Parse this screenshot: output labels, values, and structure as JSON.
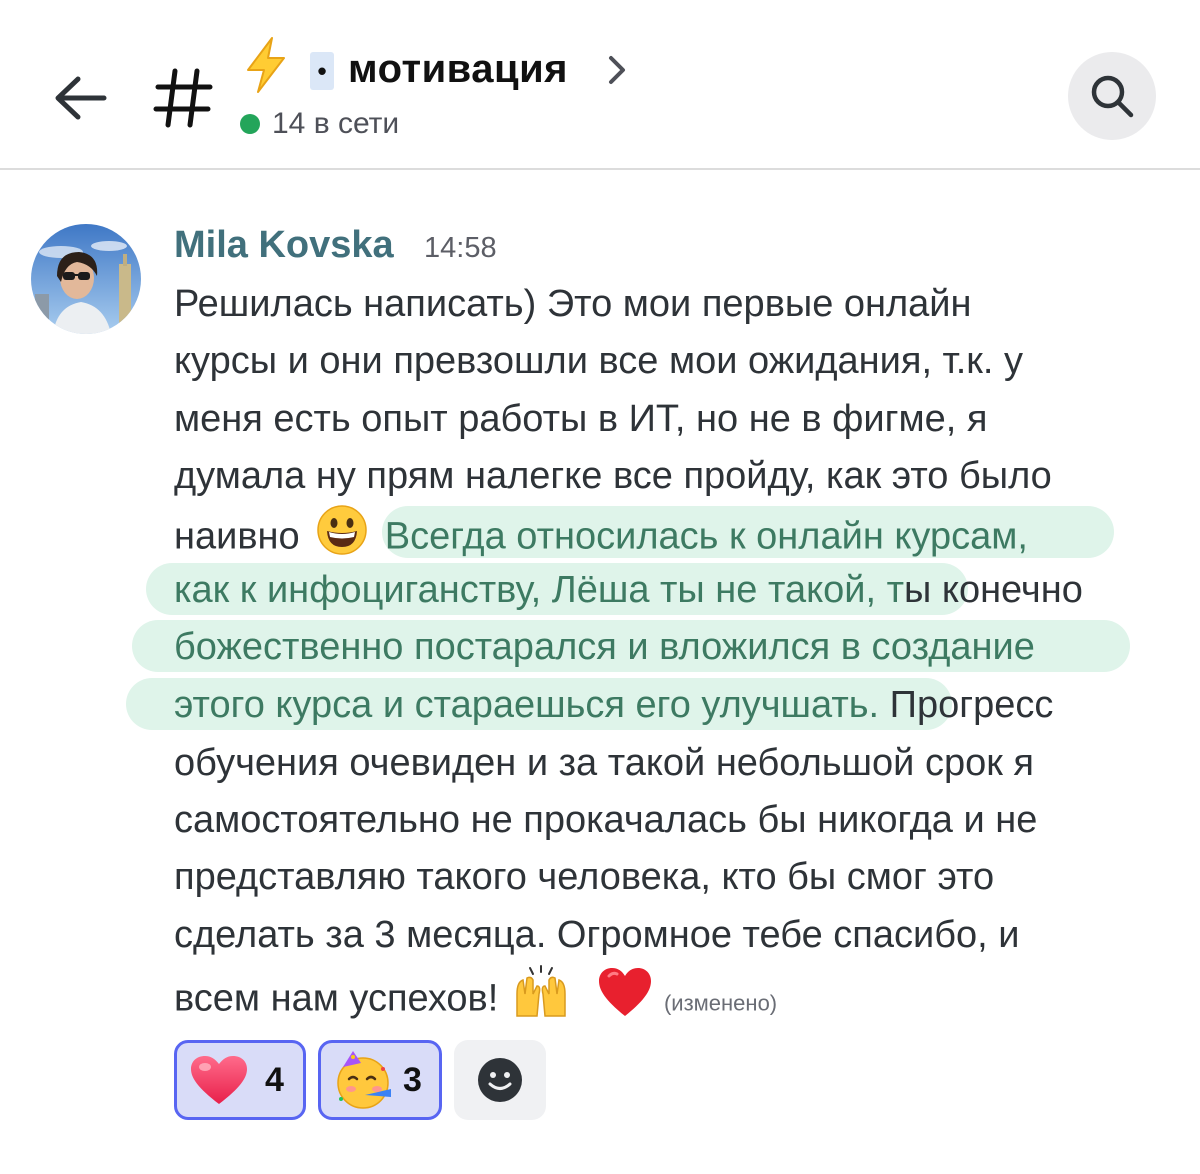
{
  "header": {
    "channel_emoji": "⚡",
    "channel_dot": "•",
    "channel_name": "мотивация",
    "online_count_text": "14 в сети",
    "online_color": "#23a55a",
    "icons": [
      "back-arrow-icon",
      "hash-icon",
      "chevron-right-icon",
      "search-icon"
    ]
  },
  "message": {
    "author": "Mila Kovska",
    "author_color": "#41707c",
    "timestamp": "14:58",
    "lines": [
      "Решилась написать) Это мои первые онлайн",
      "курсы и они превзошли все мои ожидания, т.к. у",
      "меня есть опыт работы в ИТ, но не в фигме,  я",
      "думала ну прям налегке все пройду, как это было"
    ],
    "line5_before": "наивно",
    "line5_emoji": "😀",
    "line5_highlight": "Всегда относилась к онлайн курсам,",
    "line6_highlight": "как к инфоциганству, Лёша ты не такой, т",
    "line6_after": "ы конечно",
    "line7_highlight": "божественно постарался и вложился в создание",
    "line8_highlight": "этого курса и стараешься его улучшать.",
    "line8_after": " Прогресс",
    "lines_rest": [
      "обучения очевиден  и за такой небольшой срок я",
      "самостоятельно  не прокачалась бы никогда и не",
      "представляю такого человека, кто бы смог это",
      "сделать за 3 месяца.  Огромное тебе спасибо, и"
    ],
    "last_line_text": "всем нам успехов!",
    "last_line_emoji_1": "🙌",
    "last_line_emoji_2": "❤️",
    "edited_label": "(изменено)",
    "highlight_color": "#dff4ea"
  },
  "reactions": [
    {
      "emoji": "heart-icon",
      "count": "4",
      "active": true
    },
    {
      "emoji": "partying-face-icon",
      "count": "3",
      "active": true
    }
  ],
  "add_reaction_icon": "smiley-add-icon",
  "accent_color": "#5865f2"
}
